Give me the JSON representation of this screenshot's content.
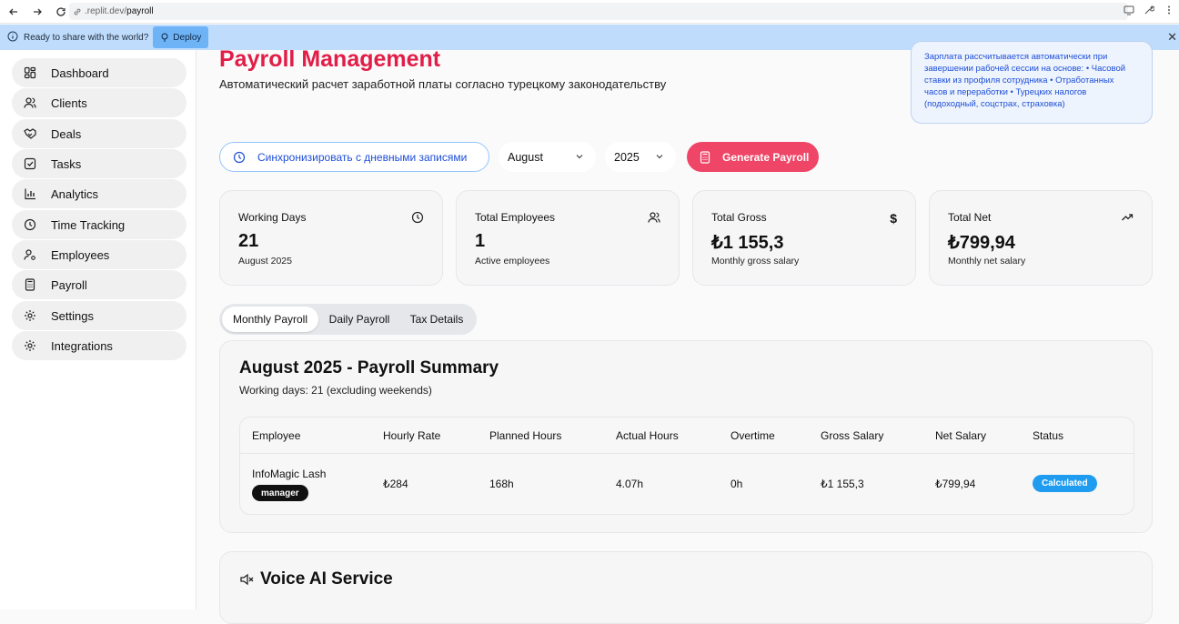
{
  "browser": {
    "url_host": ".replit.dev/",
    "url_path": "payroll"
  },
  "banner": {
    "message": "Ready to share with the world?",
    "deploy_label": "Deploy"
  },
  "sidebar": {
    "items": [
      {
        "label": "Dashboard",
        "icon": "dashboard-icon"
      },
      {
        "label": "Clients",
        "icon": "users-icon"
      },
      {
        "label": "Deals",
        "icon": "handshake-icon"
      },
      {
        "label": "Tasks",
        "icon": "checkbox-icon"
      },
      {
        "label": "Analytics",
        "icon": "bar-chart-icon"
      },
      {
        "label": "Time Tracking",
        "icon": "clock-icon"
      },
      {
        "label": "Employees",
        "icon": "user-cog-icon"
      },
      {
        "label": "Payroll",
        "icon": "calculator-icon"
      },
      {
        "label": "Settings",
        "icon": "gear-icon"
      },
      {
        "label": "Integrations",
        "icon": "gear-icon"
      }
    ]
  },
  "header": {
    "title": "Payroll Management",
    "subtitle": "Автоматический расчет заработной платы согласно турецкому законодательству",
    "info_text": "Зарплата рассчитывается автоматически при завершении рабочей сессии на основе: • Часовой ставки из профиля сотрудника • Отработанных часов и переработки • Турецких налогов (подоходный, соцстрах, страховка)"
  },
  "controls": {
    "sync_label": "Синхронизировать с дневными записями",
    "month_value": "August",
    "year_value": "2025",
    "generate_label": "Generate Payroll"
  },
  "stats": [
    {
      "label": "Working Days",
      "value": "21",
      "sub": "August 2025",
      "icon": "clock-icon"
    },
    {
      "label": "Total Employees",
      "value": "1",
      "sub": "Active employees",
      "icon": "users-icon"
    },
    {
      "label": "Total Gross",
      "value": "₺1 155,3",
      "sub": "Monthly gross salary",
      "icon": "dollar-icon"
    },
    {
      "label": "Total Net",
      "value": "₺799,94",
      "sub": "Monthly net salary",
      "icon": "trending-up-icon"
    }
  ],
  "tabs": [
    "Monthly Payroll",
    "Daily Payroll",
    "Tax Details"
  ],
  "summary": {
    "title": "August 2025 - Payroll Summary",
    "subtitle": "Working days: 21 (excluding weekends)",
    "columns": [
      "Employee",
      "Hourly Rate",
      "Planned Hours",
      "Actual Hours",
      "Overtime",
      "Gross Salary",
      "Net Salary",
      "Status"
    ],
    "rows": [
      {
        "employee": "InfoMagic Lash",
        "role": "manager",
        "hourly_rate": "₺284",
        "planned_hours": "168h",
        "actual_hours": "4.07h",
        "overtime": "0h",
        "gross_salary": "₺1 155,3",
        "net_salary": "₺799,94",
        "status": "Calculated"
      }
    ]
  },
  "voice": {
    "title": "Voice AI Service"
  },
  "colors": {
    "accent": "#e11d48",
    "generate_button": "#ef4566",
    "status_badge": "#1f9cf0",
    "info_text": "#1d4ed8"
  }
}
